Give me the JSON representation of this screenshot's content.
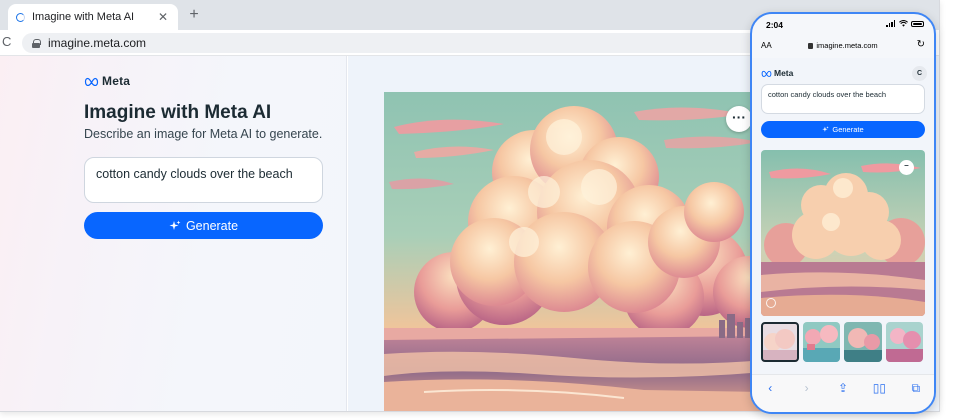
{
  "browser": {
    "tab_title": "Imagine with Meta AI",
    "tab_close": "✕",
    "new_tab": "+",
    "reload": "C",
    "url": "imagine.meta.com"
  },
  "page": {
    "brand": "Meta",
    "title": "Imagine with Meta AI",
    "subtitle": "Describe an image for Meta AI to generate.",
    "prompt_value": "cotton candy clouds over the beach",
    "generate_label": "Generate",
    "more_label": "···"
  },
  "phone": {
    "time": "2:04",
    "text_size": "AA",
    "url": "imagine.meta.com",
    "reload": "↻",
    "brand": "Meta",
    "avatar": "C",
    "prompt_value": "cotton candy clouds over the beach",
    "generate_label": "Generate",
    "more_label": "–",
    "thumbnails": [
      {
        "selected": true
      },
      {
        "selected": false
      },
      {
        "selected": false
      },
      {
        "selected": false
      }
    ],
    "nav": {
      "back": "‹",
      "forward": "›",
      "share": "⇪",
      "bookmarks": "▯▯",
      "tabs": "⧉"
    }
  },
  "colors": {
    "accent": "#0866ff",
    "phone_frame": "#3f86f5",
    "text_primary": "#1c2b33"
  }
}
